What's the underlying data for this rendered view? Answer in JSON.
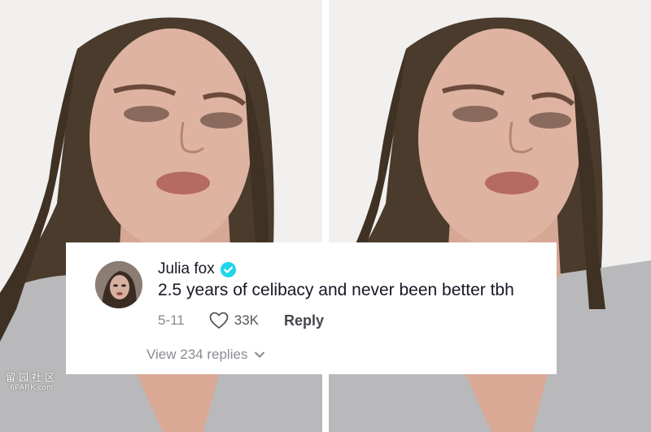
{
  "comment": {
    "username": "Julia fox",
    "verified": true,
    "text": "2.5 years of celibacy and never been better tbh",
    "date": "5-11",
    "like_count": "33K",
    "reply_label": "Reply",
    "view_replies_label": "View 234 replies"
  },
  "watermark": {
    "line1": "留园社区",
    "line2": "6PARK.com"
  },
  "colors": {
    "verified_badge": "#20d5ec",
    "text_primary": "#161823",
    "text_secondary": "#8a8b91",
    "card_background": "#ffffff"
  },
  "icons": [
    "verified-badge-icon",
    "heart-icon",
    "chevron-down-icon"
  ]
}
